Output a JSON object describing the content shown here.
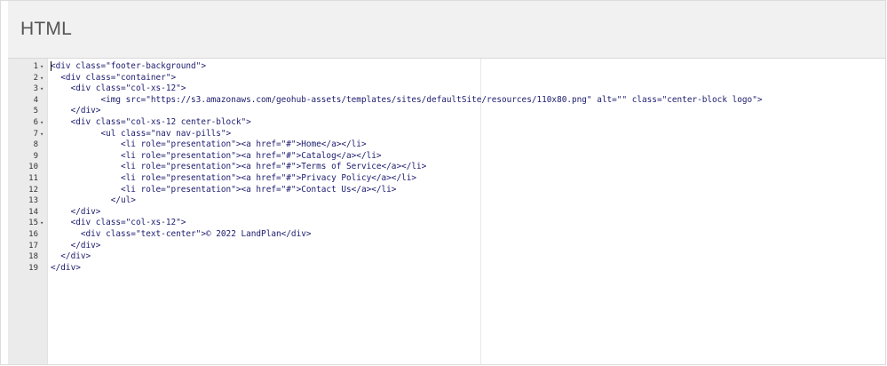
{
  "panel": {
    "title": "HTML"
  },
  "editor": {
    "lines": [
      {
        "num": "1",
        "fold": "▾",
        "text": "<div class=\"footer-background\">"
      },
      {
        "num": "2",
        "fold": "▾",
        "text": "  <div class=\"container\">"
      },
      {
        "num": "3",
        "fold": "▾",
        "text": "    <div class=\"col-xs-12\">"
      },
      {
        "num": "4",
        "fold": "",
        "text": "          <img src=\"https://s3.amazonaws.com/geohub-assets/templates/sites/defaultSite/resources/110x80.png\" alt=\"\" class=\"center-block logo\">"
      },
      {
        "num": "5",
        "fold": "",
        "text": "    </div>"
      },
      {
        "num": "6",
        "fold": "▾",
        "text": "    <div class=\"col-xs-12 center-block\">"
      },
      {
        "num": "7",
        "fold": "▾",
        "text": "          <ul class=\"nav nav-pills\">"
      },
      {
        "num": "8",
        "fold": "",
        "text": "              <li role=\"presentation\"><a href=\"#\">Home</a></li>"
      },
      {
        "num": "9",
        "fold": "",
        "text": "              <li role=\"presentation\"><a href=\"#\">Catalog</a></li>"
      },
      {
        "num": "10",
        "fold": "",
        "text": "              <li role=\"presentation\"><a href=\"#\">Terms of Service</a></li>"
      },
      {
        "num": "11",
        "fold": "",
        "text": "              <li role=\"presentation\"><a href=\"#\">Privacy Policy</a></li>"
      },
      {
        "num": "12",
        "fold": "",
        "text": "              <li role=\"presentation\"><a href=\"#\">Contact Us</a></li>"
      },
      {
        "num": "13",
        "fold": "",
        "text": "            </ul>"
      },
      {
        "num": "14",
        "fold": "",
        "text": "    </div>"
      },
      {
        "num": "15",
        "fold": "▾",
        "text": "    <div class=\"col-xs-12\">"
      },
      {
        "num": "16",
        "fold": "",
        "text": "      <div class=\"text-center\">© 2022 LandPlan</div>"
      },
      {
        "num": "17",
        "fold": "",
        "text": "    </div>"
      },
      {
        "num": "18",
        "fold": "",
        "text": "  </div>"
      },
      {
        "num": "19",
        "fold": "",
        "text": "</div>"
      }
    ]
  }
}
